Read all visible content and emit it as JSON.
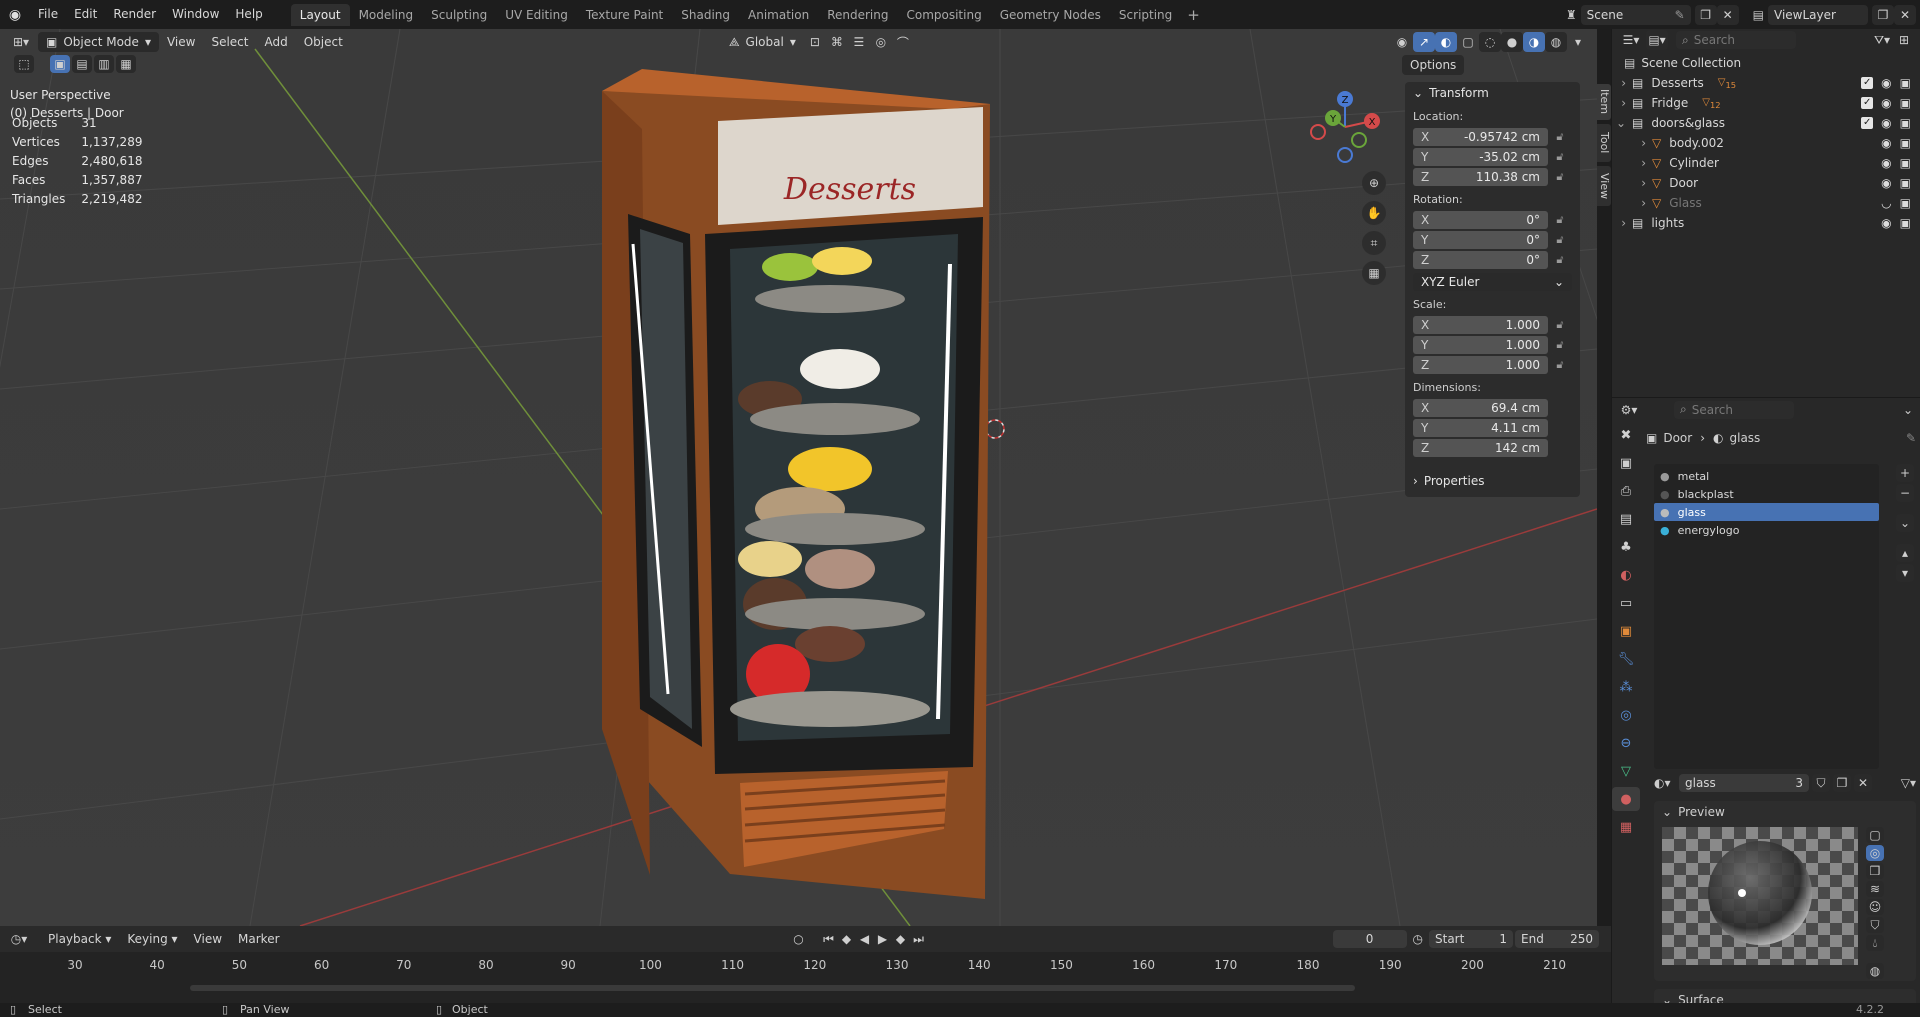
{
  "app": {
    "menus": [
      "File",
      "Edit",
      "Render",
      "Window",
      "Help"
    ],
    "workspaces": [
      "Layout",
      "Modeling",
      "Sculpting",
      "UV Editing",
      "Texture Paint",
      "Shading",
      "Animation",
      "Rendering",
      "Compositing",
      "Geometry Nodes",
      "Scripting"
    ],
    "active_workspace": "Layout",
    "scene_label": "Scene",
    "viewlayer_label": "ViewLayer",
    "version": "4.2.2"
  },
  "viewport": {
    "mode": "Object Mode",
    "menus": [
      "View",
      "Select",
      "Add",
      "Object"
    ],
    "orientation": "Global",
    "options_label": "Options",
    "perspective_label": "User Perspective",
    "context_label": "(0) Desserts | Door",
    "stats": [
      {
        "label": "Objects",
        "value": "31"
      },
      {
        "label": "Vertices",
        "value": "1,137,289"
      },
      {
        "label": "Edges",
        "value": "2,480,618"
      },
      {
        "label": "Faces",
        "value": "1,357,887"
      },
      {
        "label": "Triangles",
        "value": "2,219,482"
      }
    ],
    "gizmo_axes": {
      "x": "X",
      "y": "Y",
      "z": "Z"
    },
    "sign_text": "Desserts",
    "vertical_tabs": [
      "Item",
      "Tool",
      "View"
    ]
  },
  "npanel": {
    "transform_title": "Transform",
    "location_label": "Location:",
    "location": [
      {
        "axis": "X",
        "value": "-0.95742 cm"
      },
      {
        "axis": "Y",
        "value": "-35.02 cm"
      },
      {
        "axis": "Z",
        "value": "110.38 cm"
      }
    ],
    "rotation_label": "Rotation:",
    "rotation": [
      {
        "axis": "X",
        "value": "0°"
      },
      {
        "axis": "Y",
        "value": "0°"
      },
      {
        "axis": "Z",
        "value": "0°"
      }
    ],
    "rotation_mode": "XYZ Euler",
    "scale_label": "Scale:",
    "scale": [
      {
        "axis": "X",
        "value": "1.000"
      },
      {
        "axis": "Y",
        "value": "1.000"
      },
      {
        "axis": "Z",
        "value": "1.000"
      }
    ],
    "dimensions_label": "Dimensions:",
    "dimensions": [
      {
        "axis": "X",
        "value": "69.4 cm"
      },
      {
        "axis": "Y",
        "value": "4.11 cm"
      },
      {
        "axis": "Z",
        "value": "142 cm"
      }
    ],
    "properties_title": "Properties"
  },
  "outliner": {
    "search_placeholder": "Search",
    "root": "Scene Collection",
    "items": [
      {
        "name": "Desserts",
        "badge": "15",
        "indent": 1
      },
      {
        "name": "Fridge",
        "badge": "12",
        "indent": 1
      },
      {
        "name": "doors&glass",
        "badge": "",
        "indent": 1
      },
      {
        "name": "body.002",
        "badge": "",
        "indent": 2
      },
      {
        "name": "Cylinder",
        "badge": "",
        "indent": 2
      },
      {
        "name": "Door",
        "badge": "",
        "indent": 2
      },
      {
        "name": "Glass",
        "badge": "",
        "indent": 2
      },
      {
        "name": "lights",
        "badge": "",
        "indent": 1
      }
    ]
  },
  "properties": {
    "search_placeholder": "Search",
    "breadcrumb_object": "Door",
    "breadcrumb_material": "glass",
    "material_slots": [
      "metal",
      "blackplast",
      "glass",
      "energylogo"
    ],
    "selected_slot": "glass",
    "material_name": "glass",
    "user_count": "3",
    "preview_title": "Preview",
    "surface_title": "Surface"
  },
  "timeline": {
    "menus": [
      "Playback",
      "Keying",
      "View",
      "Marker"
    ],
    "current_frame": "0",
    "start_label": "Start",
    "start_value": "1",
    "end_label": "End",
    "end_value": "250",
    "ruler": [
      "30",
      "40",
      "50",
      "60",
      "70",
      "80",
      "90",
      "100",
      "110",
      "120",
      "130",
      "140",
      "150",
      "160",
      "170",
      "180",
      "190",
      "200",
      "210"
    ]
  },
  "status": {
    "select": "Select",
    "pan": "Pan View",
    "object": "Object"
  }
}
